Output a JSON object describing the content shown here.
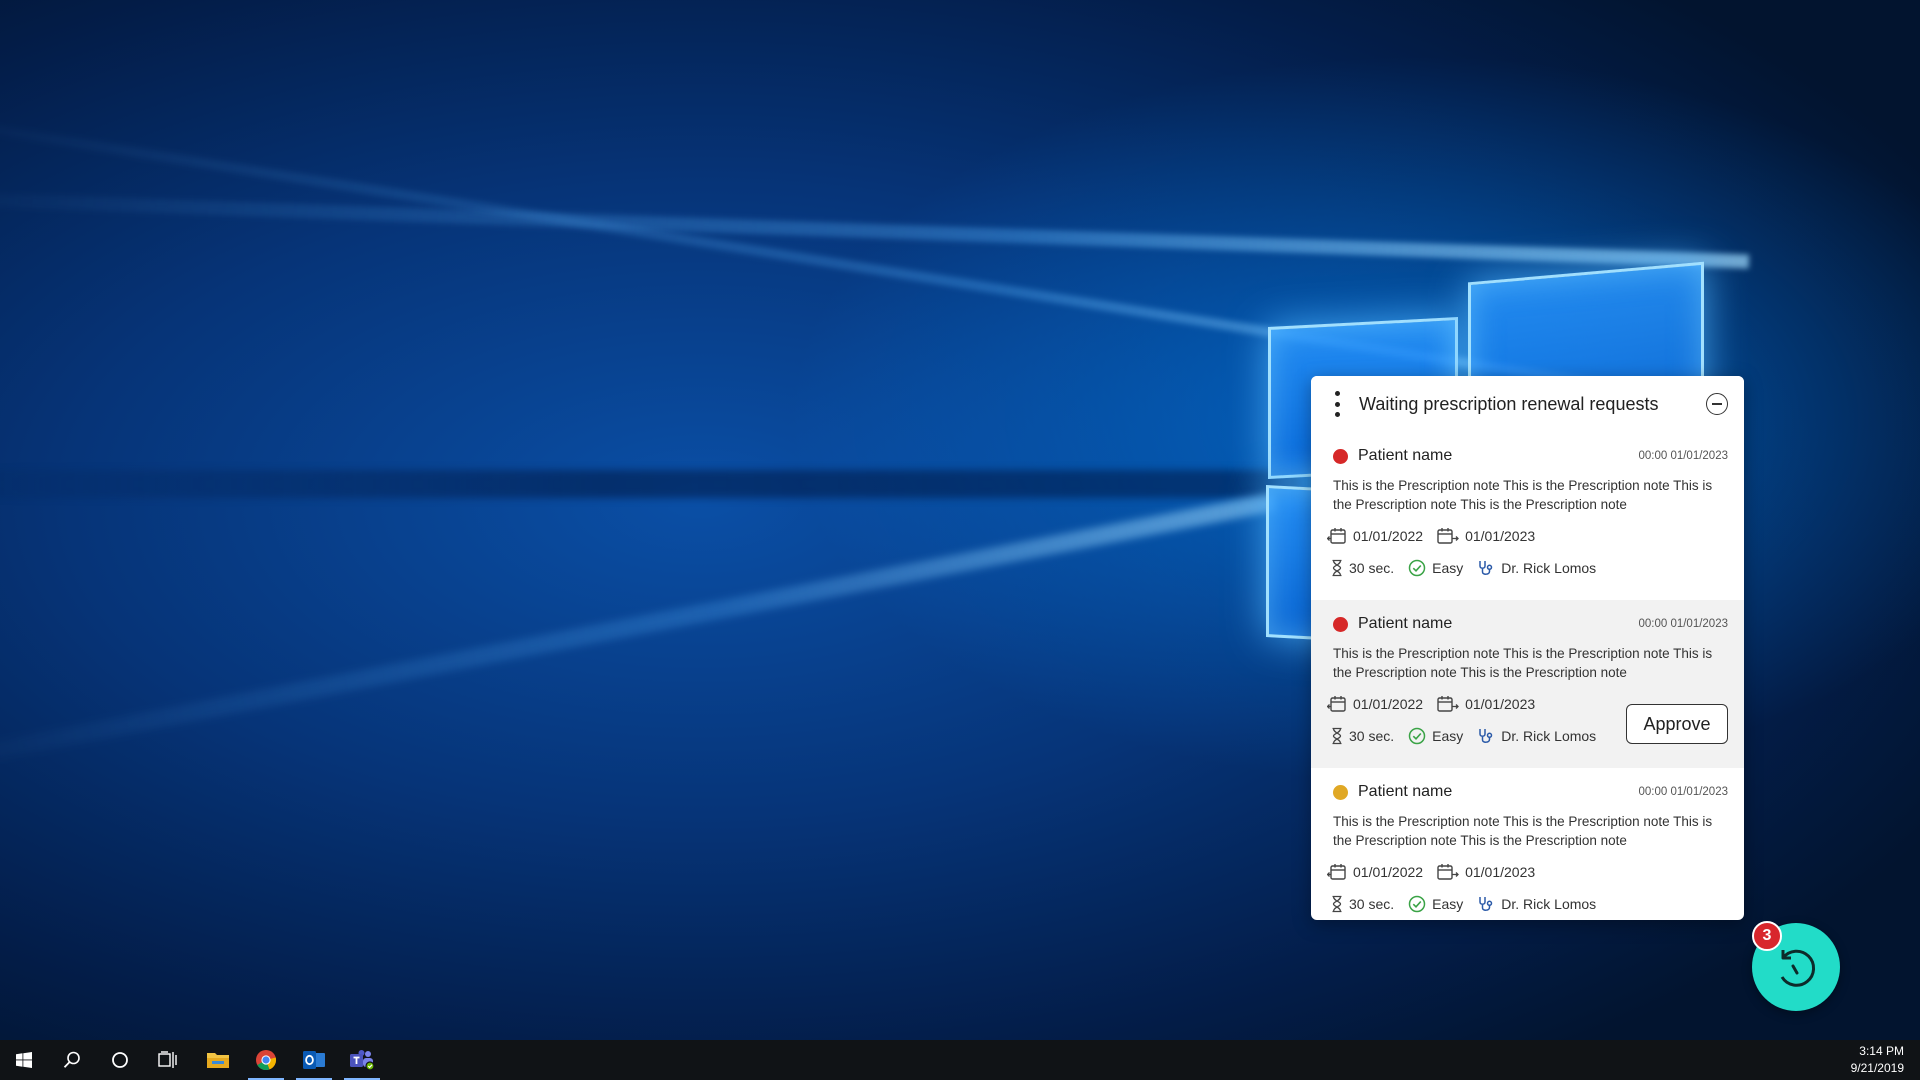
{
  "panel": {
    "title": "Waiting prescription renewal requests"
  },
  "requests": [
    {
      "patient": "Patient name",
      "timestamp": "00:00 01/01/2023",
      "status_color": "#d62828",
      "note": "This is the Prescription note This is the Prescription note This is the Prescription note This is the Prescription note",
      "start_date": "01/01/2022",
      "end_date": "01/01/2023",
      "duration": "30 sec.",
      "difficulty": "Easy",
      "doctor": "Dr. Rick Lomos"
    },
    {
      "patient": "Patient name",
      "timestamp": "00:00 01/01/2023",
      "status_color": "#d62828",
      "note": "This is the Prescription note This is the Prescription note This is the Prescription note This is the Prescription note",
      "start_date": "01/01/2022",
      "end_date": "01/01/2023",
      "duration": "30 sec.",
      "difficulty": "Easy",
      "doctor": "Dr. Rick Lomos",
      "action_label": "Approve"
    },
    {
      "patient": "Patient name",
      "timestamp": "00:00 01/01/2023",
      "status_color": "#e0a825",
      "note": "This is the Prescription note This is the Prescription note This is the Prescription note This is the Prescription note",
      "start_date": "01/01/2022",
      "end_date": "01/01/2023",
      "duration": "30 sec.",
      "difficulty": "Easy",
      "doctor": "Dr. Rick Lomos"
    }
  ],
  "fab": {
    "badge_count": "3",
    "icon": "history-icon",
    "color": "#22dcc8"
  },
  "taskbar": {
    "icons": [
      "windows-start-icon",
      "search-icon",
      "cortana-icon",
      "task-view-icon",
      "file-explorer-icon",
      "chrome-icon",
      "outlook-icon",
      "teams-icon"
    ],
    "time": "3:14 PM",
    "date": "9/21/2019"
  },
  "colors": {
    "check_green": "#3aa346",
    "doctor_blue": "#2b5aa8"
  }
}
